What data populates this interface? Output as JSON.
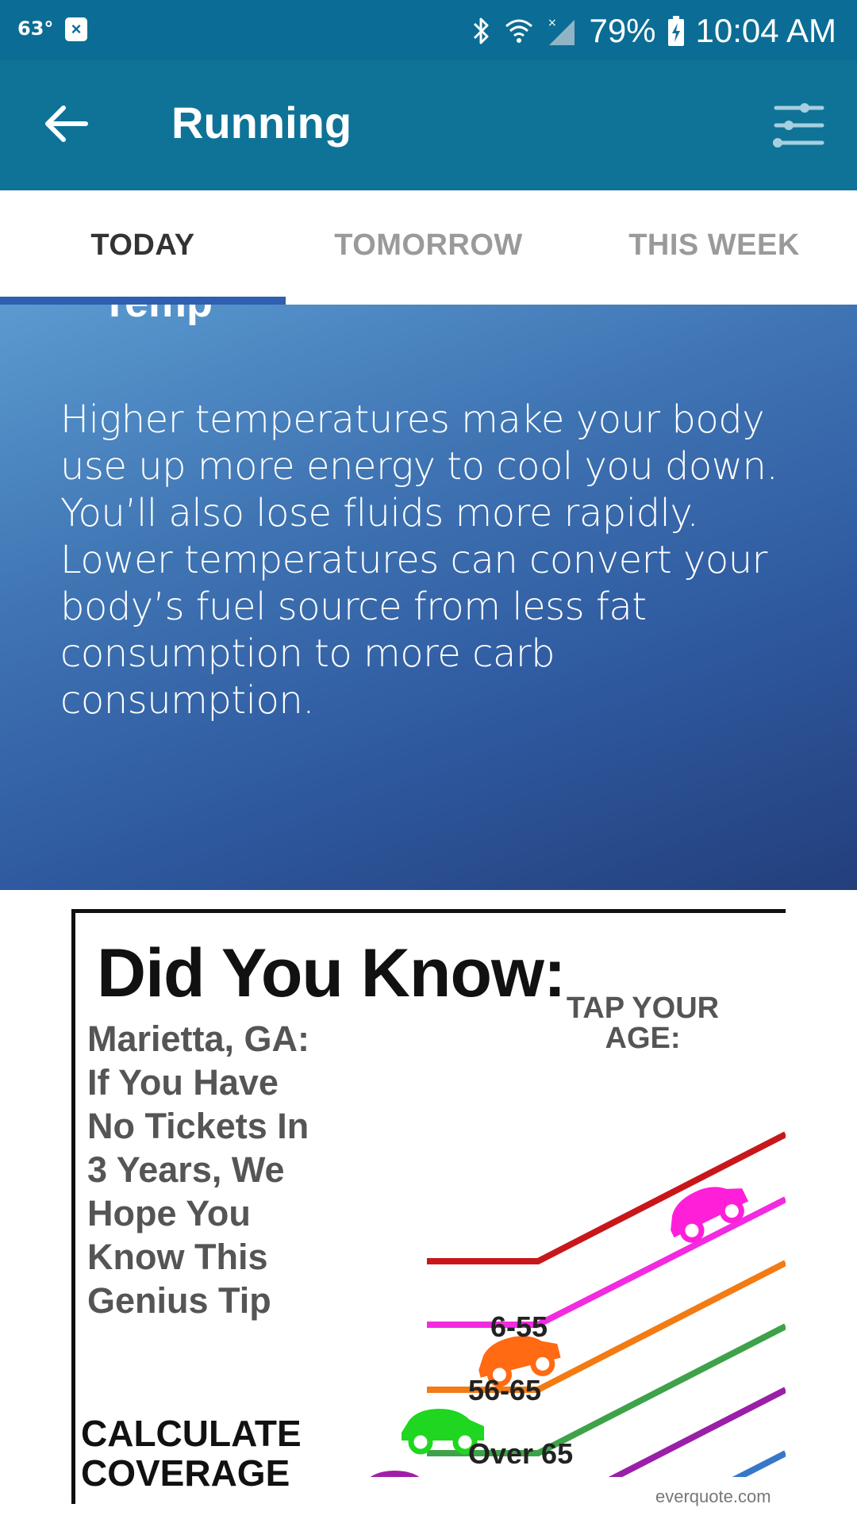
{
  "status_bar": {
    "temperature": "63°",
    "notification_icon": "x-close-icon",
    "battery": "79%",
    "time": "10:04 AM"
  },
  "app_bar": {
    "title": "Running"
  },
  "tabs": [
    {
      "label": "TODAY",
      "active": true
    },
    {
      "label": "TOMORROW",
      "active": false
    },
    {
      "label": "THIS WEEK",
      "active": false
    }
  ],
  "card": {
    "heading": "Temp",
    "body": "Higher temperatures make your body use up more energy to cool you down. You’ll also lose fluids more rapidly. Lower temperatures can convert your body’s fuel source from less fat consumption to more carb consumption."
  },
  "ad": {
    "title": "Did You Know:",
    "text_lines": [
      "Marietta, GA:",
      "If You Have",
      "No Tickets In",
      "3 Years, We",
      "Hope You",
      "Know This",
      "Genius Tip"
    ],
    "cta_lines": [
      "CALCULATE",
      "COVERAGE"
    ],
    "tap_lines": [
      "TAP YOUR",
      "AGE:"
    ],
    "age_labels": [
      "6-55",
      "56-65",
      "Over 65"
    ],
    "credit": "everquote.com",
    "colors": {
      "line_red": "#c8171b",
      "line_magenta": "#f22be0",
      "line_orange": "#f37b13",
      "line_green": "#3ea24a",
      "line_purple": "#9a1fa8",
      "line_blue": "#3777c8",
      "car_magenta": "#ff1fd8",
      "car_orange": "#ff6a13",
      "car_green": "#1fd620",
      "car_purple": "#a11fa8",
      "car_blue": "#3f79c6"
    }
  },
  "colors": {
    "status_bar": "#0b6d95",
    "app_bar": "#0e7397",
    "tab_indicator": "#2e5fb0"
  }
}
